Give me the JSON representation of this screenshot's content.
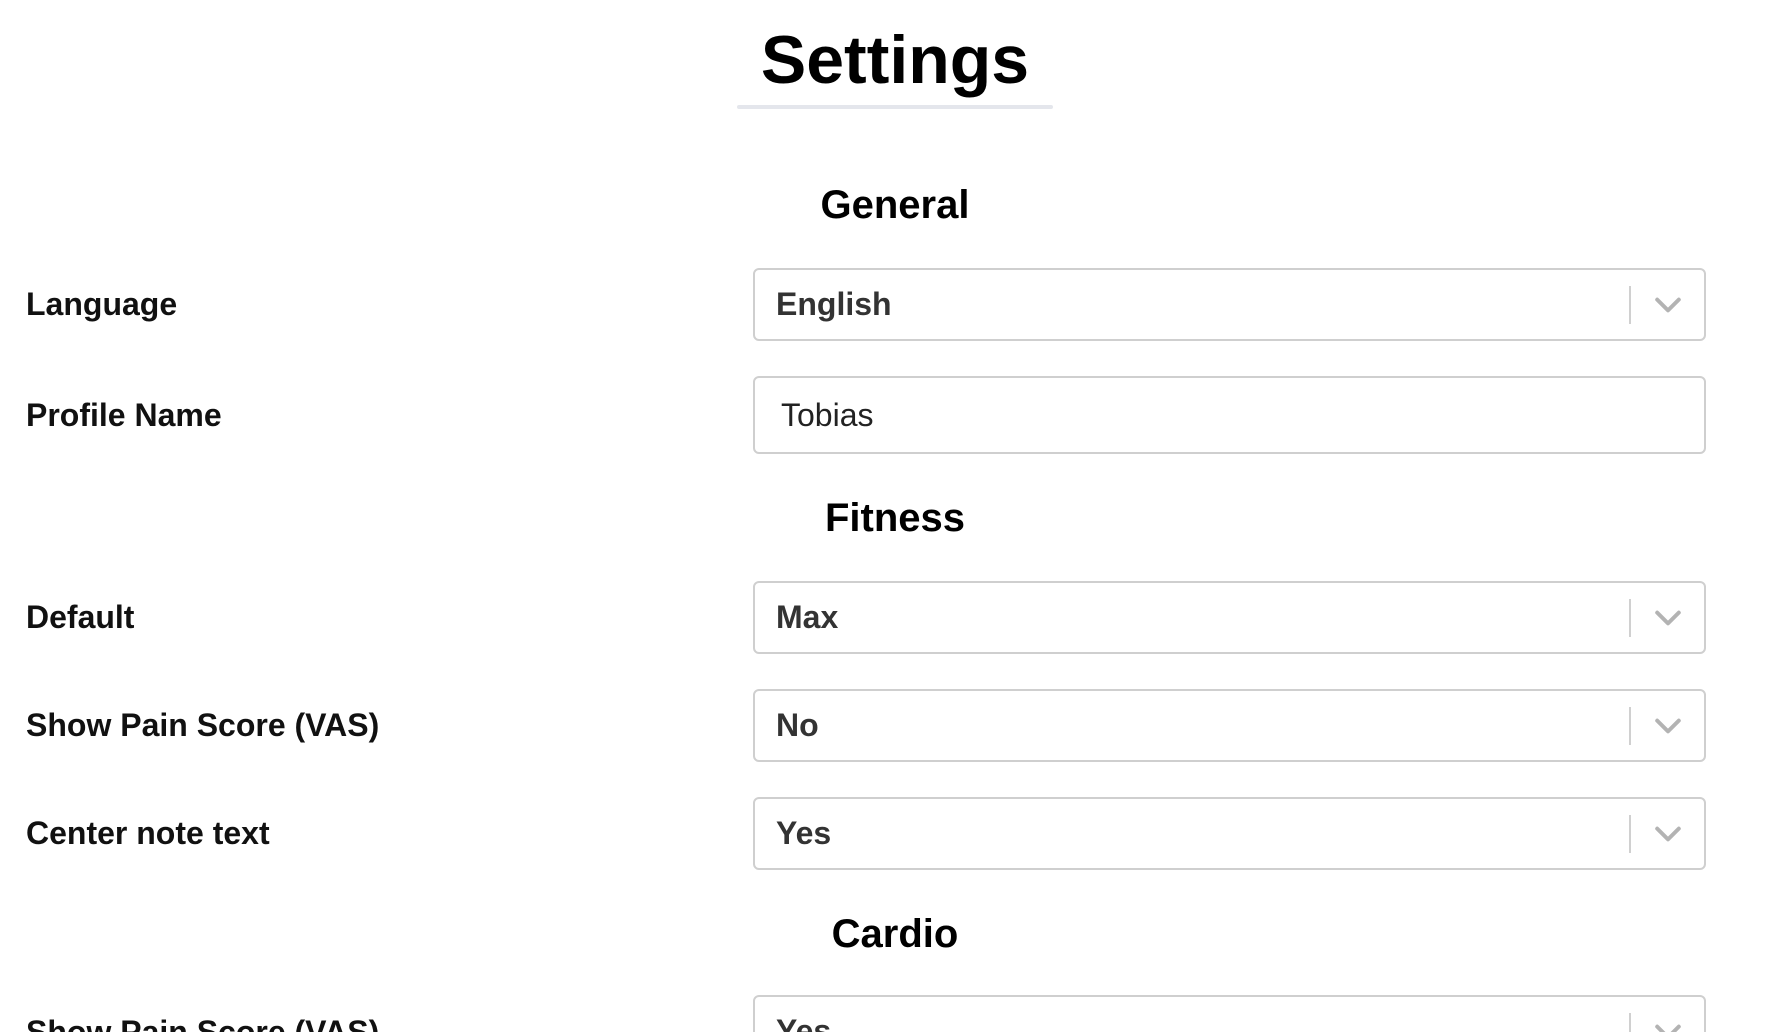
{
  "page": {
    "title": "Settings"
  },
  "sections": {
    "general": {
      "heading": "General",
      "language": {
        "label": "Language",
        "value": "English"
      },
      "profile_name": {
        "label": "Profile Name",
        "value": "Tobias"
      }
    },
    "fitness": {
      "heading": "Fitness",
      "default": {
        "label": "Default",
        "value": "Max"
      },
      "show_pain_score": {
        "label": "Show Pain Score (VAS)",
        "value": "No"
      },
      "center_note_text": {
        "label": "Center note text",
        "value": "Yes"
      }
    },
    "cardio": {
      "heading": "Cardio",
      "show_pain_score": {
        "label": "Show Pain Score (VAS)",
        "value": "Yes"
      }
    }
  },
  "icons": {
    "dropdown": "chevron-down-icon"
  },
  "colors": {
    "border": "#cfcfcf",
    "chevron": "#b3b3b3",
    "title_underline": "#e4e6ec"
  }
}
